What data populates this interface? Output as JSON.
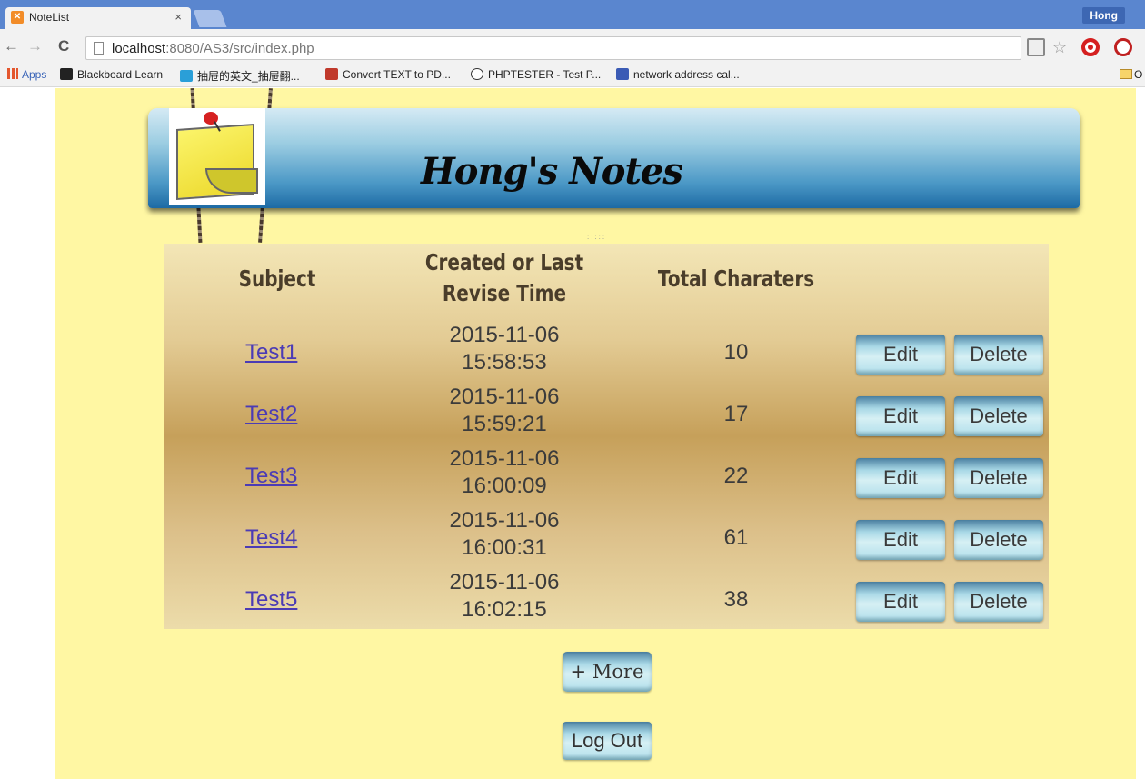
{
  "browser": {
    "tab_title": "NoteList",
    "tab_close": "×",
    "profile_name": "Hong",
    "url_host": "localhost",
    "url_rest": ":8080/AS3/src/index.php",
    "back": "←",
    "forward": "→",
    "reload": "C",
    "bookmarks": [
      {
        "label": "Apps",
        "icon": "apps-icon",
        "color": "#e4572e"
      },
      {
        "label": "Blackboard Learn",
        "icon": "blackboard-icon",
        "color": "#222222"
      },
      {
        "label": "抽屉的英文_抽屉翻...",
        "icon": "dictionary-icon",
        "color": "#2a9fd8"
      },
      {
        "label": "Convert TEXT to PD...",
        "icon": "pdf-icon",
        "color": "#c0392b"
      },
      {
        "label": "PHPTESTER - Test P...",
        "icon": "phptester-icon",
        "color": "#333333"
      },
      {
        "label": "network address cal...",
        "icon": "network-icon",
        "color": "#3b5bb5"
      }
    ],
    "bookmark_folder_label": "O"
  },
  "header": {
    "title": "Hong's Notes",
    "logo": "sticky-note-icon"
  },
  "table": {
    "columns": [
      "Subject",
      "Created or Last Revise Time",
      "Total Charaters",
      ""
    ],
    "rows": [
      {
        "subject": "Test1",
        "date": "2015-11-06",
        "time": "15:58:53",
        "chars": "10"
      },
      {
        "subject": "Test2",
        "date": "2015-11-06",
        "time": "15:59:21",
        "chars": "17"
      },
      {
        "subject": "Test3",
        "date": "2015-11-06",
        "time": "16:00:09",
        "chars": "22"
      },
      {
        "subject": "Test4",
        "date": "2015-11-06",
        "time": "16:00:31",
        "chars": "61"
      },
      {
        "subject": "Test5",
        "date": "2015-11-06",
        "time": "16:02:15",
        "chars": "38"
      }
    ],
    "edit_label": "Edit",
    "delete_label": "Delete"
  },
  "actions": {
    "more_label": "+ More",
    "logout_label": "Log Out"
  },
  "colors": {
    "paper": "#fff7a3",
    "header_blue": "#1d6aa4",
    "link": "#4b3bb5",
    "chrome_blue": "#5a86cf"
  }
}
